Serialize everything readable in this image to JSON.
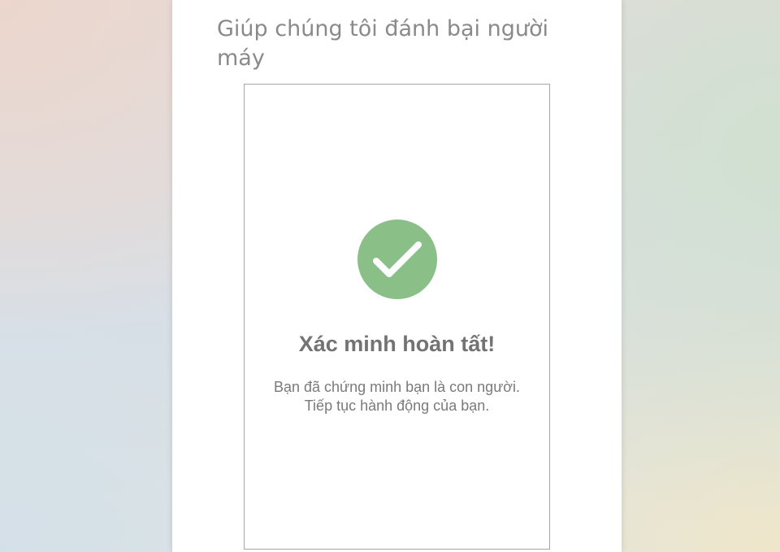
{
  "page": {
    "heading": "Giúp chúng tôi đánh bại người máy"
  },
  "verification": {
    "title": "Xác minh hoàn tất!",
    "message": "Bạn đã chứng minh bạn là con người. Tiếp tục hành động của bạn.",
    "check_color": "#8abf88"
  }
}
